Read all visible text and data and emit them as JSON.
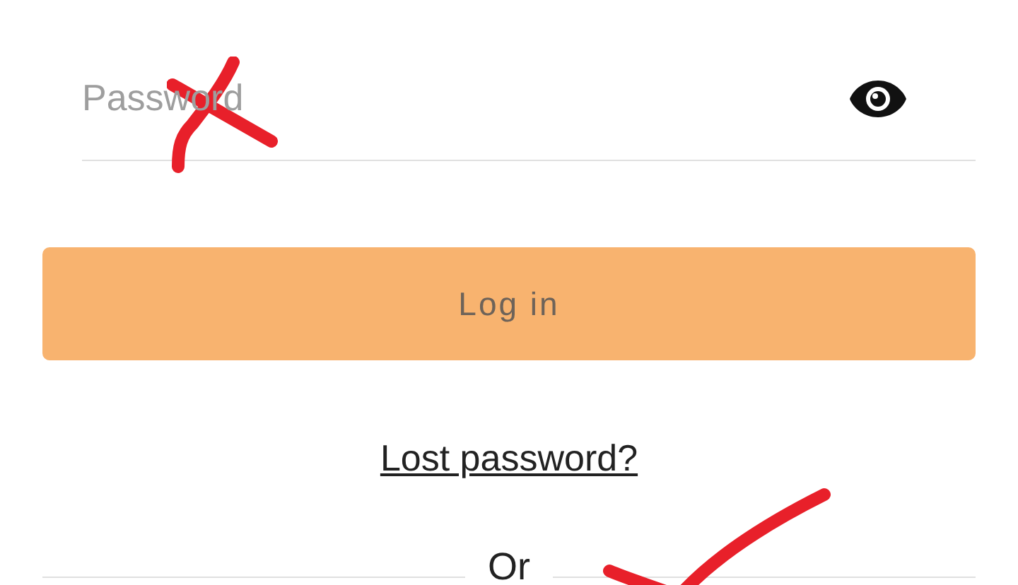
{
  "password_field": {
    "placeholder": "Password"
  },
  "login_button": {
    "label": "Log in"
  },
  "lost_password_link": "Lost password?",
  "divider_text": "Or",
  "annotations": [
    {
      "kind": "cross"
    },
    {
      "kind": "check"
    }
  ]
}
